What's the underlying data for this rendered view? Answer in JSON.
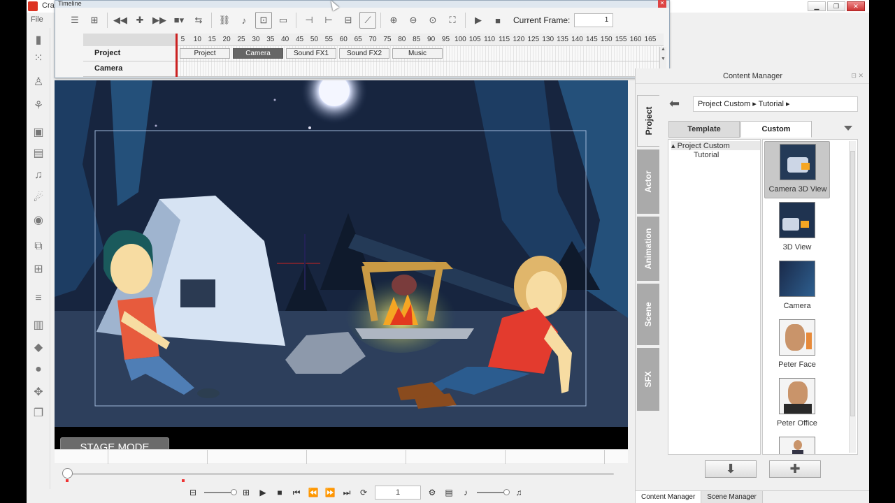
{
  "app": {
    "title": "Cra",
    "menu_file": "File"
  },
  "window": {
    "min": "▁",
    "max": "❐",
    "close": "✕"
  },
  "timeline": {
    "title": "Timeline",
    "current_frame_label": "Current Frame:",
    "current_frame_value": "1",
    "frames": [
      "5",
      "10",
      "15",
      "20",
      "25",
      "30",
      "35",
      "40",
      "45",
      "50",
      "55",
      "60",
      "65",
      "70",
      "75",
      "80",
      "85",
      "90",
      "95",
      "100",
      "105",
      "110",
      "115",
      "120",
      "125",
      "130",
      "135",
      "140",
      "145",
      "150",
      "155",
      "160",
      "165"
    ],
    "rows": [
      {
        "label": "Project"
      },
      {
        "label": "Camera"
      }
    ],
    "tabs": [
      {
        "label": "Project",
        "active": false
      },
      {
        "label": "Camera",
        "active": true
      },
      {
        "label": "Sound FX1",
        "active": false
      },
      {
        "label": "Sound FX2",
        "active": false
      },
      {
        "label": "Music",
        "active": false
      }
    ]
  },
  "stage": {
    "mode_label": "STAGE MODE"
  },
  "playback": {
    "frame_value": "1"
  },
  "content_manager": {
    "title": "Content Manager",
    "vertical_tabs": [
      "Project",
      "Actor",
      "Animation",
      "Scene",
      "SFX"
    ],
    "path": [
      "Project Custom",
      "Tutorial"
    ],
    "tabs": {
      "template": "Template",
      "custom": "Custom"
    },
    "tree": [
      {
        "label": "Project Custom",
        "expanded": true
      },
      {
        "label": "Tutorial"
      }
    ],
    "assets": [
      {
        "label": "Camera 3D View",
        "selected": true,
        "icon": "camera-3d-thumb"
      },
      {
        "label": "3D View",
        "icon": "3d-view-thumb"
      },
      {
        "label": "Camera",
        "icon": "camera-thumb"
      },
      {
        "label": "Peter Face",
        "icon": "face-thumb"
      },
      {
        "label": "Peter Office",
        "icon": "office-thumb"
      },
      {
        "label": "",
        "icon": "person-thumb"
      }
    ],
    "bottom_tabs": [
      "Content Manager",
      "Scene Manager"
    ]
  },
  "colors": {
    "accent_red": "#c22222",
    "sky": "#1a2a4a",
    "shirt_red": "#e33b2e"
  }
}
